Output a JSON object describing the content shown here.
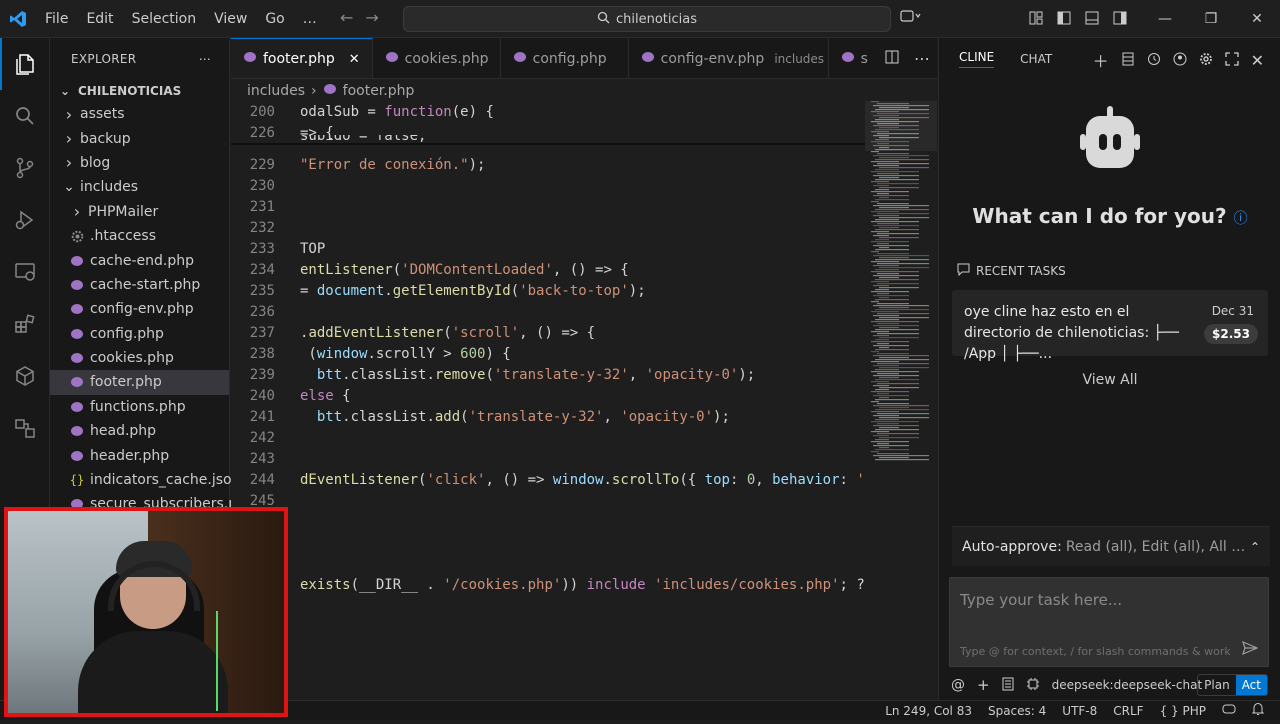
{
  "menu": {
    "items": [
      "File",
      "Edit",
      "Selection",
      "View",
      "Go",
      "…"
    ],
    "search": "chilenoticias"
  },
  "explorer": {
    "title": "EXPLORER",
    "root": "CHILENOTICIAS",
    "items": [
      {
        "label": "assets",
        "type": "folder",
        "depth": 0,
        "expanded": false
      },
      {
        "label": "backup",
        "type": "folder",
        "depth": 0,
        "expanded": false
      },
      {
        "label": "blog",
        "type": "folder",
        "depth": 0,
        "expanded": false
      },
      {
        "label": "includes",
        "type": "folder",
        "depth": 0,
        "expanded": true
      },
      {
        "label": "PHPMailer",
        "type": "folder",
        "depth": 1,
        "expanded": false
      },
      {
        "label": ".htaccess",
        "type": "gear",
        "depth": 1
      },
      {
        "label": "cache-end.php",
        "type": "php",
        "depth": 1
      },
      {
        "label": "cache-start.php",
        "type": "php",
        "depth": 1
      },
      {
        "label": "config-env.php",
        "type": "php",
        "depth": 1
      },
      {
        "label": "config.php",
        "type": "php",
        "depth": 1
      },
      {
        "label": "cookies.php",
        "type": "php",
        "depth": 1
      },
      {
        "label": "footer.php",
        "type": "php",
        "depth": 1,
        "selected": true
      },
      {
        "label": "functions.php",
        "type": "php",
        "depth": 1
      },
      {
        "label": "head.php",
        "type": "php",
        "depth": 1
      },
      {
        "label": "header.php",
        "type": "php",
        "depth": 1
      },
      {
        "label": "indicators_cache.json",
        "type": "json",
        "depth": 1
      },
      {
        "label": "secure_subscribers.p",
        "type": "php",
        "depth": 1
      }
    ]
  },
  "tabs": [
    {
      "label": "footer.php",
      "active": true,
      "close": "✕"
    },
    {
      "label": "cookies.php",
      "active": false
    },
    {
      "label": "config.php",
      "active": false
    },
    {
      "label": "config-env.php",
      "active": false,
      "sub": "includes"
    },
    {
      "label": "s",
      "active": false
    }
  ],
  "breadcrumb": {
    "folder": "includes",
    "sep": "›",
    "file": "footer.php"
  },
  "code": [
    {
      "n": "200",
      "t": "odalSub = function(e) {"
    },
    {
      "n": "226",
      "t": "=> {"
    },
    {
      "n": "",
      "t": "subido = false;"
    },
    {
      "n": "229",
      "t": "\"Error de conexión.\");"
    },
    {
      "n": "230",
      "t": ""
    },
    {
      "n": "231",
      "t": ""
    },
    {
      "n": "232",
      "t": ""
    },
    {
      "n": "233",
      "t": "TOP"
    },
    {
      "n": "234",
      "t": "entListener('DOMContentLoaded', () => {"
    },
    {
      "n": "235",
      "t": "= document.getElementById('back-to-top');"
    },
    {
      "n": "236",
      "t": ""
    },
    {
      "n": "237",
      "t": ".addEventListener('scroll', () => {"
    },
    {
      "n": "238",
      "t": " (window.scrollY > 600) {"
    },
    {
      "n": "239",
      "t": "  btt.classList.remove('translate-y-32', 'opacity-0');"
    },
    {
      "n": "240",
      "t": "else {"
    },
    {
      "n": "241",
      "t": "  btt.classList.add('translate-y-32', 'opacity-0');"
    },
    {
      "n": "242",
      "t": ""
    },
    {
      "n": "243",
      "t": ""
    },
    {
      "n": "244",
      "t": "dEventListener('click', () => window.scrollTo({ top: 0, behavior: 'smo"
    },
    {
      "n": "245",
      "t": ""
    },
    {
      "n": "",
      "t": ""
    },
    {
      "n": "",
      "t": ""
    },
    {
      "n": "",
      "t": ""
    },
    {
      "n": "",
      "t": "exists(__DIR__ . '/cookies.php')) include 'includes/cookies.php'; ?>"
    }
  ],
  "cline": {
    "tab_cline": "CLINE",
    "tab_chat": "CHAT",
    "heading": "What can I do for you?",
    "recent_title": "RECENT TASKS",
    "task": {
      "text": "oye cline haz esto en el directorio de chilenoticias: ├── /App │  ├──...",
      "date": "Dec 31",
      "cost": "$2.53"
    },
    "view_all": "View All",
    "auto_approve_label": "Auto-approve:",
    "auto_approve_value": "Read (all), Edit (all), All Comm...",
    "input_placeholder": "Type your task here...",
    "input_hint": "Type @ for context, / for slash commands & workf...",
    "model": "deepseek:deepseek-chat",
    "plan": "Plan",
    "act": "Act"
  },
  "status": {
    "position": "Ln 249, Col 83",
    "spaces": "Spaces: 4",
    "encoding": "UTF-8",
    "eol": "CRLF",
    "braces": "{ }",
    "language": "PHP"
  },
  "colors": {
    "accent": "#0078d4",
    "php_icon": "#a074c4",
    "json_icon": "#cbcb41",
    "keyword": "#c586c0",
    "function": "#dcdcaa",
    "string": "#ce9178",
    "variable": "#9cdcfe",
    "number": "#b5cea8",
    "webcam_border": "#e01414"
  }
}
